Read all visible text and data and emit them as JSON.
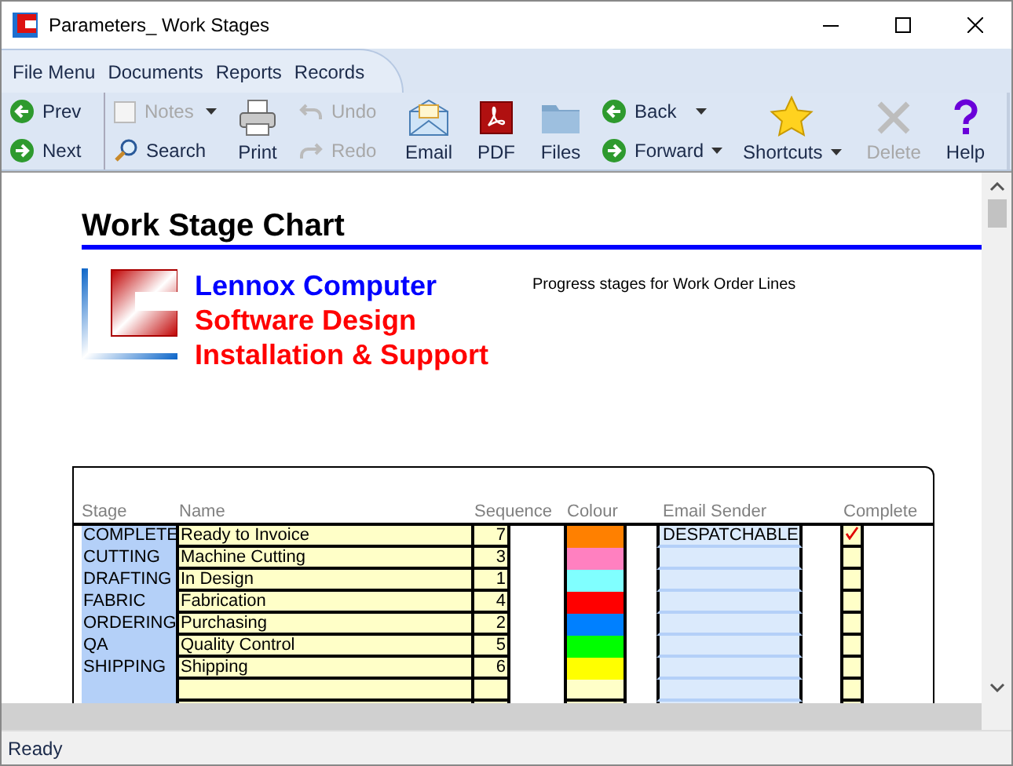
{
  "window": {
    "title": "Parameters_ Work Stages"
  },
  "menu": [
    "File Menu",
    "Documents",
    "Reports",
    "Records"
  ],
  "toolbar": [
    {
      "kind": "stack",
      "buttons": [
        {
          "label": "Prev",
          "disabled": false,
          "dropdown": false
        },
        {
          "label": "Next",
          "disabled": false,
          "dropdown": false
        }
      ]
    },
    {
      "kind": "stack",
      "buttons": [
        {
          "label": "Notes",
          "disabled": true,
          "dropdown": true
        },
        {
          "label": "Search",
          "disabled": false,
          "dropdown": false
        }
      ]
    },
    {
      "kind": "big",
      "buttons": [
        {
          "label": "Print",
          "disabled": false,
          "dropdown": false
        }
      ]
    },
    {
      "kind": "stack",
      "buttons": [
        {
          "label": "Undo",
          "disabled": true,
          "dropdown": false
        },
        {
          "label": "Redo",
          "disabled": true,
          "dropdown": false
        }
      ]
    },
    {
      "kind": "big",
      "buttons": [
        {
          "label": "Email",
          "disabled": false,
          "dropdown": false
        }
      ]
    },
    {
      "kind": "big",
      "buttons": [
        {
          "label": "PDF",
          "disabled": false,
          "dropdown": false
        }
      ]
    },
    {
      "kind": "big",
      "buttons": [
        {
          "label": "Files",
          "disabled": false,
          "dropdown": false
        }
      ]
    },
    {
      "kind": "stack",
      "buttons": [
        {
          "label": "Back",
          "disabled": false,
          "dropdown": true
        },
        {
          "label": "Forward",
          "disabled": false,
          "dropdown": true
        }
      ]
    },
    {
      "kind": "big",
      "buttons": [
        {
          "label": "Shortcuts",
          "disabled": false,
          "dropdown": true
        }
      ]
    },
    {
      "kind": "big",
      "buttons": [
        {
          "label": "Delete",
          "disabled": true,
          "dropdown": false
        }
      ]
    },
    {
      "kind": "big",
      "buttons": [
        {
          "label": "Help",
          "disabled": false,
          "dropdown": false
        }
      ]
    }
  ],
  "report": {
    "title": "Work Stage Chart",
    "company": [
      "Lennox Computer",
      "Software Design",
      "Installation & Support"
    ],
    "description": "Progress stages for Work Order Lines"
  },
  "table": {
    "columns": [
      "Stage",
      "Name",
      "Sequence",
      "Colour",
      "Email Sender",
      "Complete"
    ],
    "rows": [
      {
        "stage": "COMPLETE",
        "name": "Ready to Invoice",
        "sequence": "7",
        "color": "#ff8000",
        "email_sender": "DESPATCHABLE",
        "complete": true
      },
      {
        "stage": "CUTTING",
        "name": "Machine Cutting",
        "sequence": "3",
        "color": "#ff80c0",
        "complete": false
      },
      {
        "stage": "DRAFTING",
        "name": "In Design",
        "sequence": "1",
        "color": "#80ffff",
        "complete": false
      },
      {
        "stage": "FABRIC",
        "name": "Fabrication",
        "sequence": "4",
        "color": "#ff0000",
        "complete": false
      },
      {
        "stage": "ORDERING",
        "name": "Purchasing",
        "sequence": "2",
        "color": "#0080ff",
        "complete": false
      },
      {
        "stage": "QA",
        "name": "Quality Control",
        "sequence": "5",
        "color": "#00ff00",
        "complete": false
      },
      {
        "stage": "SHIPPING",
        "name": "Shipping",
        "sequence": "6",
        "color": "#ffff00",
        "complete": false
      }
    ]
  },
  "status_bar": {
    "text": "Ready"
  }
}
